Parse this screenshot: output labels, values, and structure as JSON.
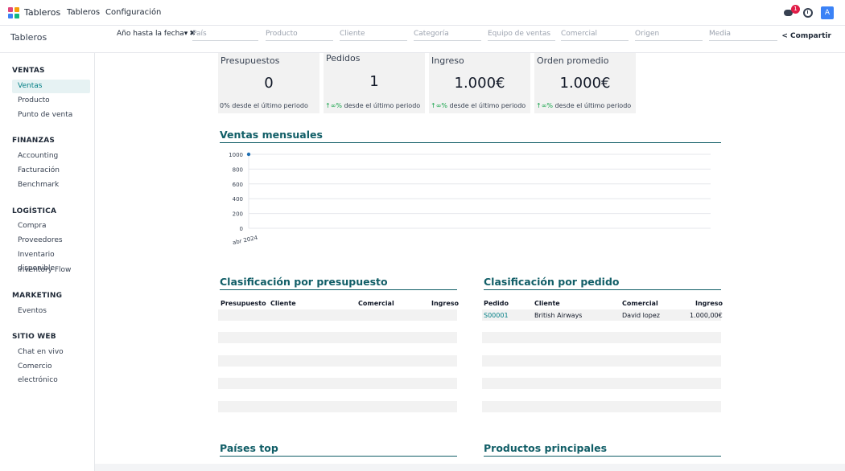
{
  "app": {
    "brand": "Tableros",
    "menu": [
      "Tableros",
      "Configuración"
    ],
    "notification_count": "1",
    "avatar_letter": "A",
    "colors": {
      "accent": "#017e84",
      "title": "#115e67",
      "badge": "#e11d48",
      "avatar": "#3b82f6"
    }
  },
  "control": {
    "breadcrumb": "Tableros",
    "facet": "Año hasta la fecha",
    "filters": [
      "País",
      "Producto",
      "Cliente",
      "Categoría",
      "Equipo de ventas",
      "Comercial",
      "Origen",
      "Media"
    ],
    "share": "Compartir"
  },
  "sidebar": {
    "sections": [
      {
        "title": "VENTAS",
        "items": [
          "Ventas",
          "Producto",
          "Punto de venta"
        ]
      },
      {
        "title": "FINANZAS",
        "items": [
          "Accounting",
          "Facturación",
          "Benchmark"
        ]
      },
      {
        "title": "LOGÍSTICA",
        "items": [
          "Compra",
          "Proveedores",
          "Inventario disponible",
          "Inventory Flow"
        ]
      },
      {
        "title": "MARKETING",
        "items": [
          "Eventos"
        ]
      },
      {
        "title": "SITIO WEB",
        "items": [
          "Chat en vivo",
          "Comercio electrónico"
        ]
      }
    ],
    "active": "Ventas"
  },
  "kpis": [
    {
      "label": "Presupuestos",
      "value": "0",
      "compare_prefix": "",
      "compare": "0% desde el último periodo"
    },
    {
      "label": "Pedidos",
      "value": "1",
      "compare_prefix": "↑∞%",
      "compare": " desde el último periodo"
    },
    {
      "label": "Ingreso",
      "value": "1.000€",
      "compare_prefix": "↑∞%",
      "compare": " desde el último periodo"
    },
    {
      "label": "Orden promedio",
      "value": "1.000€",
      "compare_prefix": "↑∞%",
      "compare": " desde el último periodo"
    }
  ],
  "sections": {
    "monthly": "Ventas mensuales",
    "by_quote": "Clasificación por presupuesto",
    "by_order": "Clasificación por pedido",
    "countries": "Países top",
    "products": "Productos principales"
  },
  "quote_table": {
    "headers": [
      "Presupuesto",
      "Cliente",
      "Comercial",
      "Ingreso"
    ]
  },
  "order_table": {
    "headers": [
      "Pedido",
      "Cliente",
      "Comercial",
      "Ingreso"
    ],
    "rows": [
      [
        "S00001",
        "British Airways",
        "David lopez",
        "1.000,00€"
      ]
    ]
  },
  "chart_data": {
    "type": "line",
    "x": [
      "abr 2024"
    ],
    "series": [
      {
        "values": [
          1000
        ]
      }
    ],
    "ylim": [
      0,
      1000
    ],
    "yticks": [
      "0",
      "200",
      "400",
      "600",
      "800",
      "1000"
    ],
    "grid": true,
    "point_color": "#1f6fb2"
  }
}
